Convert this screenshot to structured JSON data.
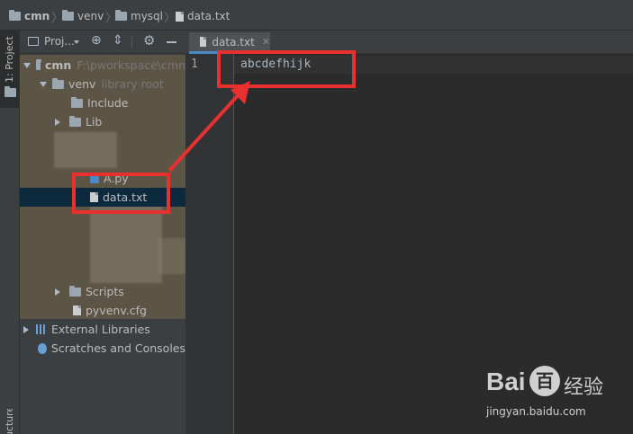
{
  "breadcrumb": {
    "items": [
      "cmn",
      "venv",
      "mysql",
      "data.txt"
    ]
  },
  "tool_strip": {
    "project_tab": "1: Project",
    "structure_tab": "Structure"
  },
  "project_panel": {
    "title": "Proj...",
    "tree": {
      "root_name": "cmn",
      "root_path": "F:\\pworkspace\\cmn",
      "venv_name": "venv",
      "venv_note": "library root",
      "include": "Include",
      "lib": "Lib",
      "a_py": "A.py",
      "data_txt": "data.txt",
      "scripts": "Scripts",
      "pyvenv": "pyvenv.cfg",
      "external": "External Libraries",
      "scratches": "Scratches and Consoles"
    }
  },
  "editor": {
    "tab_label": "data.txt",
    "line_number": "1",
    "line_text": "abcdefhijk"
  },
  "watermark": {
    "brand": "Bai",
    "brand_tail": "百",
    "suffix": "经验",
    "url": "jingyan.baidu.com"
  },
  "colors": {
    "annotation": "#e8312f",
    "selection": "#0d293e",
    "tab_underline": "#4a88c7"
  }
}
